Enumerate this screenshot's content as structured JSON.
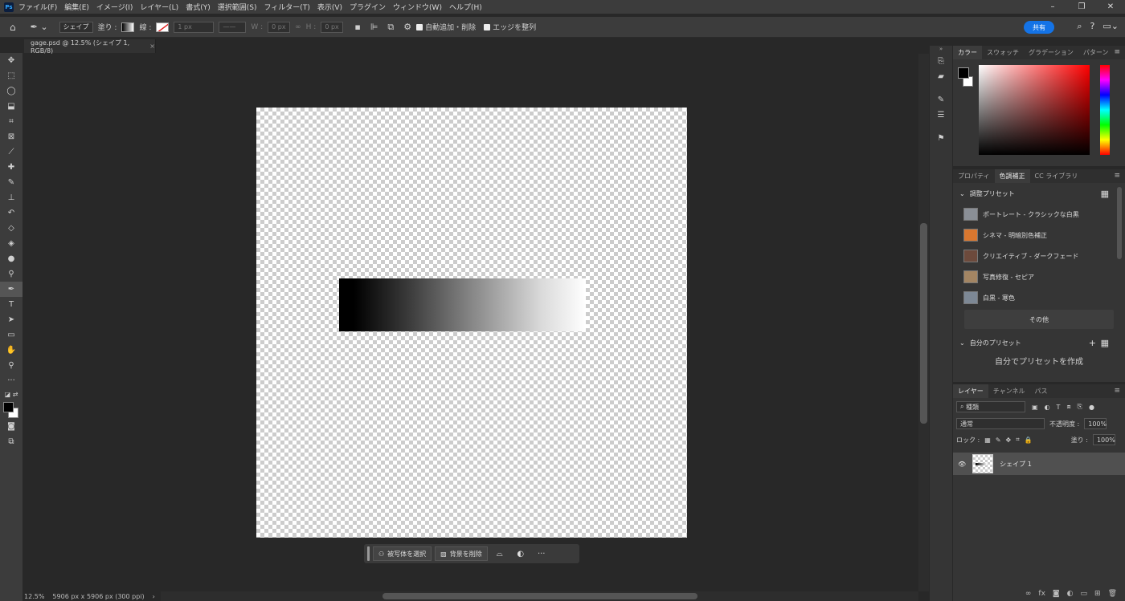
{
  "app": {
    "logo": "Ps"
  },
  "menu": [
    "ファイル(F)",
    "編集(E)",
    "イメージ(I)",
    "レイヤー(L)",
    "書式(Y)",
    "選択範囲(S)",
    "フィルター(T)",
    "表示(V)",
    "プラグイン",
    "ウィンドウ(W)",
    "ヘルプ(H)"
  ],
  "window_controls": {
    "minimize": "–",
    "restore": "❐",
    "close": "✕"
  },
  "options": {
    "tool_mode": "シェイプ",
    "fill_label": "塗り :",
    "stroke_label": "線 :",
    "stroke_width": "1 px",
    "w_label": "W :",
    "w_value": "0 px",
    "h_label": "H :",
    "h_value": "0 px",
    "auto_add_delete": "自動追加・削除",
    "align_edges": "エッジを整列",
    "share_button": "共有"
  },
  "document": {
    "tab_title": "gage.psd @ 12.5% (シェイプ 1, RGB/8)",
    "zoom": "12.5%",
    "size_info": "5906 px x 5906 px (300 ppi)"
  },
  "contextual_taskbar": {
    "select_subject": "被写体を選択",
    "remove_background": "背景を削除"
  },
  "color_panel": {
    "tabs": [
      "カラー",
      "スウォッチ",
      "グラデーション",
      "パターン"
    ],
    "hue_color": "#ff0000",
    "foreground": "#000000",
    "background": "#ffffff"
  },
  "adjustments_panel": {
    "tabs": [
      "プロパティ",
      "色調補正",
      "CC ライブラリ"
    ],
    "section_title": "調整プリセット",
    "presets": [
      {
        "label": "ポートレート - クラシックな白黒",
        "thumb": "#8a8f96"
      },
      {
        "label": "シネマ - 明暗別色補正",
        "thumb": "#d9772f"
      },
      {
        "label": "クリエイティブ - ダークフェード",
        "thumb": "#6d4a3c"
      },
      {
        "label": "写真修復 - セピア",
        "thumb": "#a38563"
      },
      {
        "label": "白黒 - 寒色",
        "thumb": "#7d8895"
      }
    ],
    "more_button": "その他",
    "my_presets_title": "自分のプリセット",
    "create_hint": "自分でプリセットを作成"
  },
  "layers_panel": {
    "tabs": [
      "レイヤー",
      "チャンネル",
      "パス"
    ],
    "filter_kind": "種類",
    "blend_mode": "通常",
    "opacity_label": "不透明度 :",
    "opacity_value": "100%",
    "lock_label": "ロック :",
    "fill_label": "塗り :",
    "fill_value": "100%",
    "layers": [
      {
        "name": "シェイプ 1"
      }
    ]
  }
}
